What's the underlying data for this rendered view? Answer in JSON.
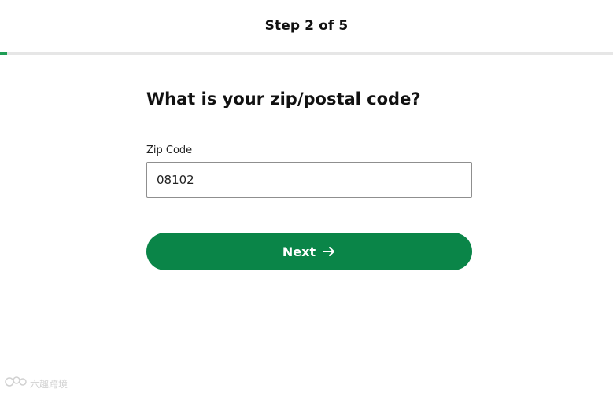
{
  "header": {
    "step_text": "Step 2 of 5",
    "progress_fraction": 0.011
  },
  "form": {
    "question": "What is your zip/postal code?",
    "zip_label": "Zip Code",
    "zip_value": "08102",
    "next_label": "Next",
    "next_icon": "arrow-right-icon"
  },
  "watermark": {
    "text": "六趣跨境"
  },
  "colors": {
    "accent": "#0a8548",
    "progress": "#1f9d55",
    "track": "#e6e6e6"
  }
}
